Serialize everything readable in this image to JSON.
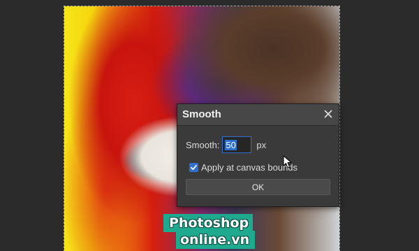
{
  "dialog": {
    "title": "Smooth",
    "smooth_label": "Smooth:",
    "smooth_value": "50",
    "unit": "px",
    "apply_checkbox_label": "Apply at canvas bounds",
    "apply_checked": true,
    "ok_label": "OK"
  },
  "watermark": {
    "line1": "Photoshop",
    "line2": "online.vn"
  },
  "colors": {
    "dialog_bg": "#3a3a3a",
    "accent": "#2f6fcf",
    "watermark_bg": "#1fa98f"
  },
  "icons": {
    "close": "close-icon",
    "check": "checkmark-icon",
    "cursor": "mouse-pointer-icon"
  }
}
